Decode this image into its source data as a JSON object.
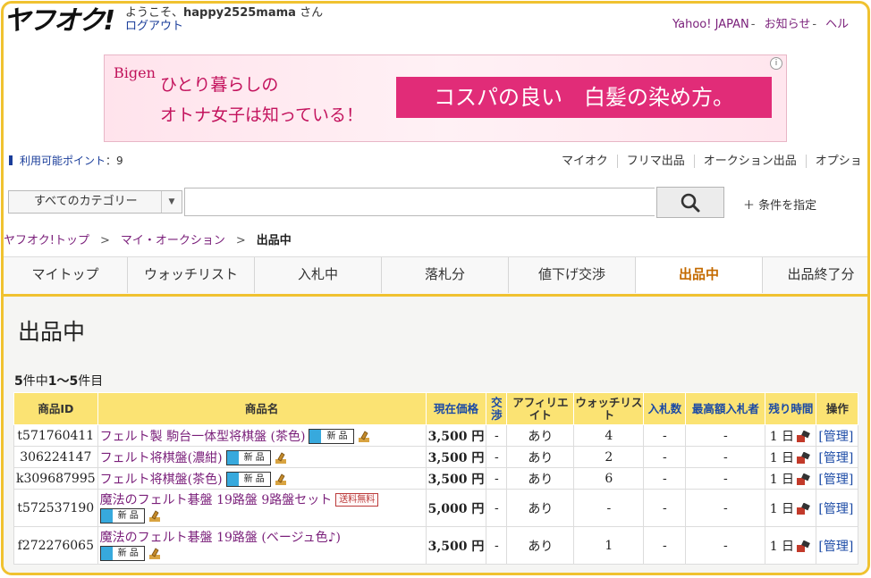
{
  "header": {
    "logo_text": "ヤフオク!",
    "welcome_prefix": "ようこそ、",
    "username": "happy2525mama",
    "welcome_suffix": " さん",
    "logout": "ログアウト",
    "links": [
      "Yahoo! JAPAN",
      "お知らせ",
      "ヘル"
    ]
  },
  "ad": {
    "brand": "Bigen",
    "copy_line1": "ひとり暮らしの",
    "copy_line2": "オトナ女子は知っている！",
    "band_text": "コスパの良い　白髪の染め方。"
  },
  "points": {
    "label": "利用可能ポイント",
    "value": "：9"
  },
  "menu": [
    "マイオク",
    "フリマ出品",
    "オークション出品",
    "オプショ"
  ],
  "search": {
    "category": "すべてのカテゴリー",
    "placeholder": "",
    "conditions": "＋ 条件を指定"
  },
  "breadcrumb": {
    "items": [
      "ヤフオク!トップ",
      "マイ・オークション"
    ],
    "current": "出品中"
  },
  "tabs": [
    {
      "label": "マイトップ",
      "active": false
    },
    {
      "label": "ウォッチリスト",
      "active": false
    },
    {
      "label": "入札中",
      "active": false
    },
    {
      "label": "落札分",
      "active": false
    },
    {
      "label": "値下げ交渉",
      "active": false
    },
    {
      "label": "出品中",
      "active": true
    },
    {
      "label": "出品終了分",
      "active": false
    }
  ],
  "page_title": "出品中",
  "result_count": {
    "total": "5",
    "mid1": "件中",
    "range": "1〜5",
    "mid2": "件目"
  },
  "table": {
    "headers": {
      "id": "商品ID",
      "name": "商品名",
      "price": "現在価格",
      "nego": "交渉",
      "affiliate": "アフィリエイト",
      "watch": "ウォッチリスト",
      "bids": "入札数",
      "top_bidder": "最高額入札者",
      "remaining": "残り時間",
      "action": "操作"
    },
    "new_badge": "新 品",
    "free_ship_badge": "送料無料",
    "manage_label": "[管理]",
    "rows": [
      {
        "id": "t571760411",
        "name": "フェルト製 駒台一体型将棋盤 (茶色)",
        "price": "3,500 円",
        "nego": "-",
        "affiliate": "あり",
        "watch": "4",
        "bids": "-",
        "top_bidder": "-",
        "remaining": "1 日"
      },
      {
        "id": "306224147",
        "name": "フェルト将棋盤(濃紺)",
        "price": "3,500 円",
        "nego": "-",
        "affiliate": "あり",
        "watch": "2",
        "bids": "-",
        "top_bidder": "-",
        "remaining": "1 日"
      },
      {
        "id": "k309687995",
        "name": "フェルト将棋盤(茶色)",
        "price": "3,500 円",
        "nego": "-",
        "affiliate": "あり",
        "watch": "6",
        "bids": "-",
        "top_bidder": "-",
        "remaining": "1 日"
      },
      {
        "id": "t572537190",
        "name": "魔法のフェルト碁盤 19路盤 9路盤セット",
        "price": "5,000 円",
        "nego": "-",
        "affiliate": "あり",
        "watch": "-",
        "bids": "-",
        "top_bidder": "-",
        "remaining": "1 日"
      },
      {
        "id": "f272276065",
        "name": "魔法のフェルト碁盤 19路盤 (ベージュ色♪)",
        "price": "3,500 円",
        "nego": "-",
        "affiliate": "あり",
        "watch": "1",
        "bids": "-",
        "top_bidder": "-",
        "remaining": "1 日"
      }
    ]
  },
  "colors": {
    "accent_yellow": "#f0c230",
    "header_yellow": "#fbe373",
    "link_purple": "#7a1f7a",
    "link_blue": "#1b4aa5"
  }
}
